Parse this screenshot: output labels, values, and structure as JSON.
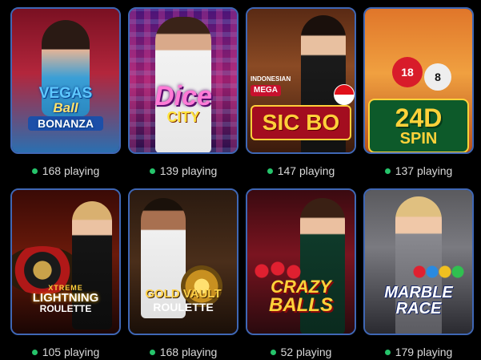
{
  "games": [
    {
      "logo_lines": [
        "VEGAS",
        "Ball",
        "BONANZA"
      ],
      "players": "168",
      "status": "playing",
      "dot_color": "#26c46b"
    },
    {
      "logo_lines": [
        "Dice",
        "CITY"
      ],
      "players": "139",
      "status": "playing",
      "dot_color": "#26c46b"
    },
    {
      "logo_lines": [
        "INDONESIAN",
        "MEGA",
        "SIC BO"
      ],
      "players": "147",
      "status": "playing",
      "dot_color": "#26c46b"
    },
    {
      "logo_lines": [
        "24D",
        "SPIN"
      ],
      "players": "137",
      "status": "playing",
      "dot_color": "#26c46b"
    },
    {
      "logo_lines": [
        "XTREME",
        "LIGHTNING",
        "ROULETTE"
      ],
      "players": "105",
      "status": "playing",
      "dot_color": "#26c46b"
    },
    {
      "logo_lines": [
        "GOLD VAULT",
        "ROULETTE"
      ],
      "players": "168",
      "status": "playing",
      "dot_color": "#26c46b"
    },
    {
      "logo_lines": [
        "CRAZY",
        "BALLS"
      ],
      "players": "52",
      "status": "playing",
      "dot_color": "#26c46b"
    },
    {
      "logo_lines": [
        "MARBLE",
        "RACE"
      ],
      "players": "179",
      "status": "playing",
      "dot_color": "#26c46b"
    }
  ]
}
